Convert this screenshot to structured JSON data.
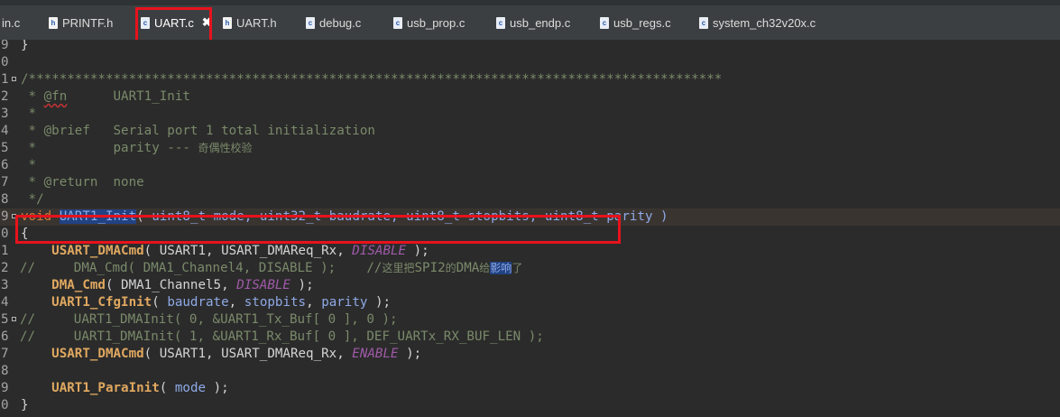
{
  "tabs": [
    {
      "icon": "",
      "label": "in.c"
    },
    {
      "icon": "h",
      "label": "PRINTF.h"
    },
    {
      "icon": "c",
      "label": "UART.c"
    },
    {
      "icon": "h",
      "label": "UART.h"
    },
    {
      "icon": "c",
      "label": "debug.c"
    },
    {
      "icon": "c",
      "label": "usb_prop.c"
    },
    {
      "icon": "c",
      "label": "usb_endp.c"
    },
    {
      "icon": "c",
      "label": "usb_regs.c"
    },
    {
      "icon": "c",
      "label": "system_ch32v20x.c"
    }
  ],
  "active_tab_close": "✖",
  "colors": {
    "highlight_box": "#e8121c",
    "selection": "#214283"
  },
  "lines": [
    {
      "num": "9",
      "parts": [
        "}"
      ]
    },
    {
      "num": "0",
      "parts": [
        ""
      ]
    },
    {
      "num": "1",
      "parts": [
        "/******************************************************************************************"
      ]
    },
    {
      "num": "2",
      "parts": [
        " * ",
        "@fn",
        "      UART1_Init"
      ]
    },
    {
      "num": "3",
      "parts": [
        " *"
      ]
    },
    {
      "num": "4",
      "parts": [
        " * @brief   Serial port 1 total initialization"
      ]
    },
    {
      "num": "5",
      "parts": [
        " *          parity --- ",
        "奇偶性校验"
      ]
    },
    {
      "num": "6",
      "parts": [
        " *"
      ]
    },
    {
      "num": "7",
      "parts": [
        " * @return  none"
      ]
    },
    {
      "num": "8",
      "parts": [
        " */"
      ]
    },
    {
      "num": "9",
      "parts": [
        "void",
        " ",
        "UART1_Init",
        "( ",
        "uint8_t",
        " mode, ",
        "uint32_t",
        " baudrate, ",
        "uint8_t",
        " stopbits, ",
        "uint8_t",
        " parity )"
      ]
    },
    {
      "num": "0",
      "parts": [
        "{"
      ]
    },
    {
      "num": "1",
      "parts": [
        "    ",
        "USART_DMACmd",
        "( USART1, USART_DMAReq_Rx, ",
        "DISABLE",
        " );"
      ]
    },
    {
      "num": "2",
      "parts": [
        "//     DMA_Cmd( DMA1_Channel4, DISABLE );    //",
        "这里把",
        "SPI2",
        "的",
        "DMA",
        "给",
        "影",
        "响",
        "了"
      ]
    },
    {
      "num": "3",
      "parts": [
        "    ",
        "DMA_Cmd",
        "( DMA1_Channel5, ",
        "DISABLE",
        " );"
      ]
    },
    {
      "num": "4",
      "parts": [
        "    ",
        "UART1_CfgInit",
        "( ",
        "baudrate",
        ", ",
        "stopbits",
        ", ",
        "parity",
        " );"
      ]
    },
    {
      "num": "5",
      "parts": [
        "//     UART1_DMAInit( 0, &UART1_Tx_Buf[ 0 ], 0 );"
      ]
    },
    {
      "num": "6",
      "parts": [
        "//     UART1_DMAInit( 1, &UART1_Rx_Buf[ 0 ], DEF_UARTx_RX_BUF_LEN );"
      ]
    },
    {
      "num": "7",
      "parts": [
        "    ",
        "USART_DMACmd",
        "( USART1, USART_DMAReq_Rx, ",
        "ENABLE",
        " );"
      ]
    },
    {
      "num": "8",
      "parts": [
        ""
      ]
    },
    {
      "num": "9",
      "parts": [
        "    ",
        "UART1_ParaInit",
        "( ",
        "mode",
        " );"
      ]
    },
    {
      "num": "0",
      "parts": [
        "}"
      ]
    }
  ]
}
